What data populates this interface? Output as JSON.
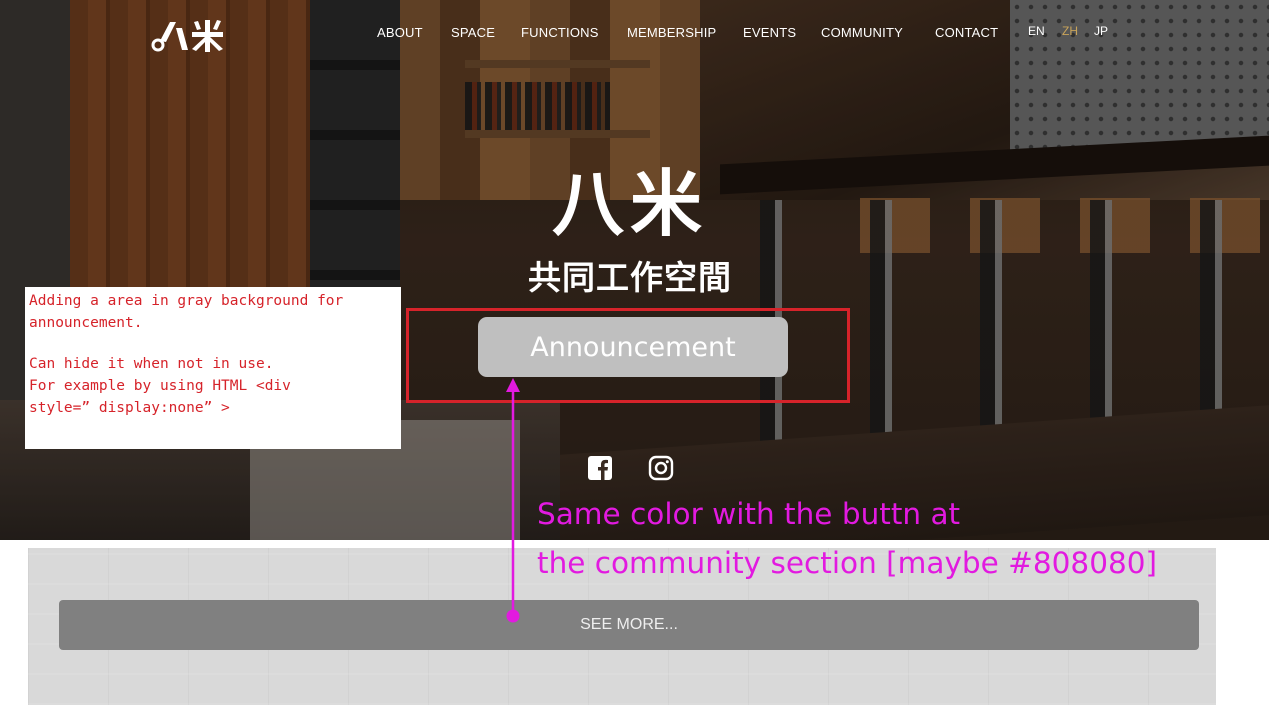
{
  "nav": {
    "logo_icon": "bami-logo-icon",
    "items": [
      {
        "label": "ABOUT"
      },
      {
        "label": "SPACE"
      },
      {
        "label": "FUNCTIONS"
      },
      {
        "label": "MEMBERSHIP"
      },
      {
        "label": "EVENTS"
      },
      {
        "label": "COMMUNITY"
      },
      {
        "label": "CONTACT"
      }
    ],
    "languages": [
      {
        "label": "EN"
      },
      {
        "label": "ZH",
        "active": true
      },
      {
        "label": "JP"
      }
    ]
  },
  "hero": {
    "title": "八米",
    "subtitle": "共同工作空間",
    "announcement_label": "Announcement",
    "announcement_color": "#bfbfbf",
    "social": [
      {
        "icon": "facebook-icon"
      },
      {
        "icon": "instagram-icon"
      }
    ]
  },
  "annotations": {
    "note_lines": [
      "Adding a area in gray background for",
      "announcement.",
      "Can hide it when not in use.",
      "For example by using HTML <div",
      "style=” display:none” >"
    ],
    "magenta_line1": "Same color with the buttn at",
    "magenta_line2": "the community section [maybe #808080]",
    "note_color": "#d6232a",
    "magenta_color": "#e21ae0"
  },
  "community": {
    "see_more_label": "SEE MORE...",
    "button_color": "#808080"
  }
}
